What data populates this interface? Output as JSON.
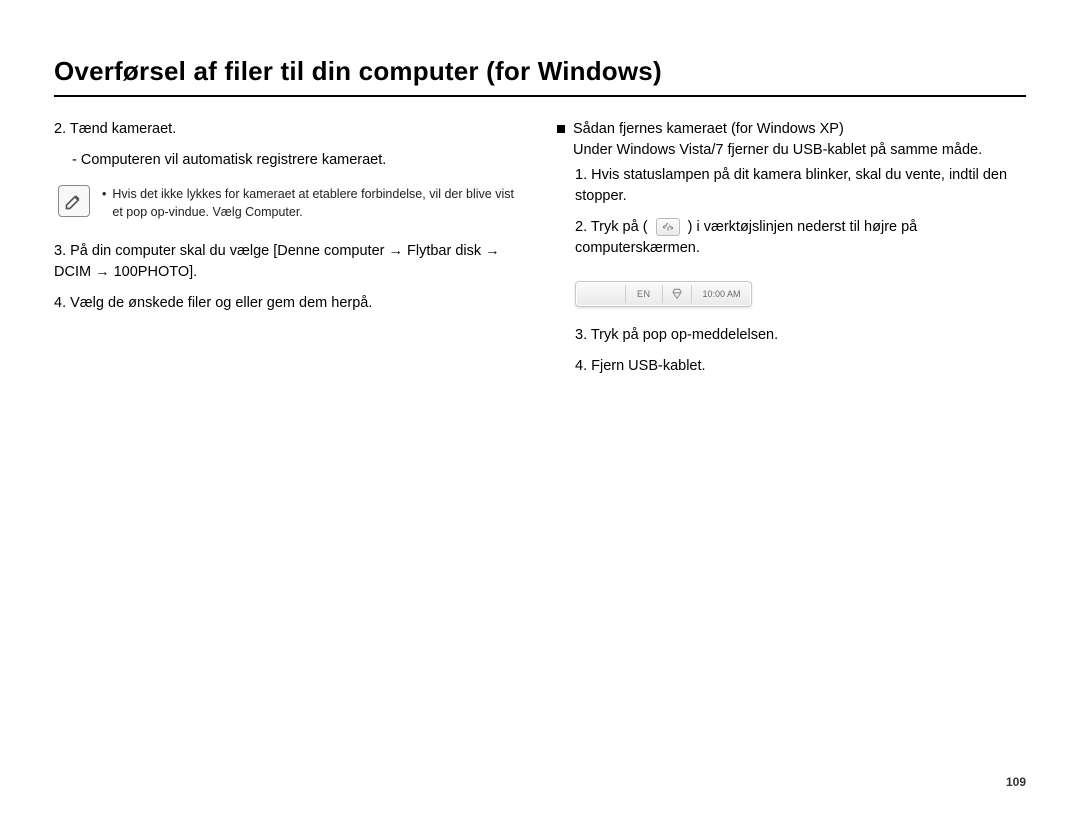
{
  "title": "Overførsel af filer til din computer (for Windows)",
  "left": {
    "step2": "2. Tænd kameraet.",
    "step2_sub": "- Computeren vil automatisk registrere kameraet.",
    "note": "Hvis det ikke lykkes for kameraet at etablere forbindelse, vil der blive vist et pop op-vindue. Vælg Computer.",
    "step3": "3. På din computer skal du vælge [Denne computer → Flytbar disk → DCIM → 100PHOTO].",
    "step4": "4. Vælg de ønskede filer og eller gem dem herpå."
  },
  "right": {
    "head": "Sådan fjernes kameraet (for Windows XP)",
    "head_sub": "Under Windows Vista/7 fjerner du USB-kablet på samme måde.",
    "r1": "1. Hvis statuslampen på dit kamera blinker, skal du vente, indtil den stopper.",
    "r2a": "2. Tryk på (",
    "r2b": ") i værktøjslinjen nederst til højre på computerskærmen.",
    "tray": {
      "lang": "EN",
      "time": "10:00 AM"
    },
    "r3": "3. Tryk på pop op-meddelelsen.",
    "r4": "4. Fjern USB-kablet."
  },
  "page_number": "109"
}
